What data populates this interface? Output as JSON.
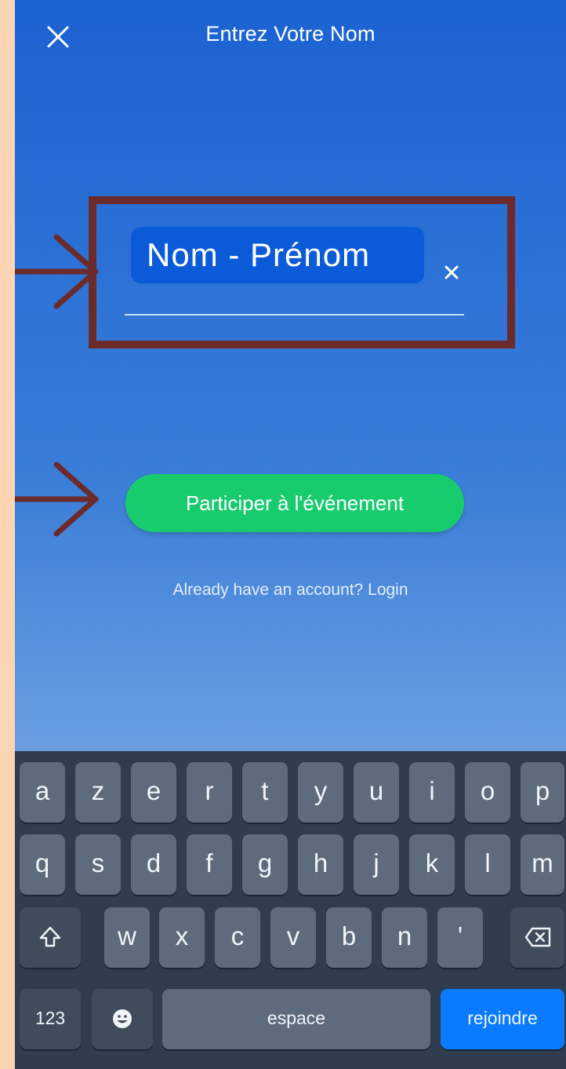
{
  "header": {
    "title": "Entrez Votre Nom",
    "close_icon": "close-icon"
  },
  "form": {
    "name_field": {
      "value": "Nom - Prénom",
      "clear_icon": "clear-icon"
    },
    "join_button_label": "Participer à l'événement",
    "login_link": "Already have an account? Login"
  },
  "annotations": {
    "color": "#6b2b2b",
    "icon": "arrow-right-icon"
  },
  "colors": {
    "background_top": "#1b62d2",
    "join_button": "#18cc6e",
    "field_highlight": "#0b5bd9",
    "page_border": "#fcd6b4",
    "keyboard_action": "#0a7bff"
  },
  "keyboard": {
    "row1": [
      "a",
      "z",
      "e",
      "r",
      "t",
      "y",
      "u",
      "i",
      "o",
      "p"
    ],
    "row2": [
      "q",
      "s",
      "d",
      "f",
      "g",
      "h",
      "j",
      "k",
      "l",
      "m"
    ],
    "row3": [
      "w",
      "x",
      "c",
      "v",
      "b",
      "n",
      "'"
    ],
    "shift_icon": "shift-icon",
    "backspace_icon": "backspace-icon",
    "numbers_label": "123",
    "emoji_icon": "emoji-icon",
    "space_label": "espace",
    "return_label": "rejoindre"
  }
}
